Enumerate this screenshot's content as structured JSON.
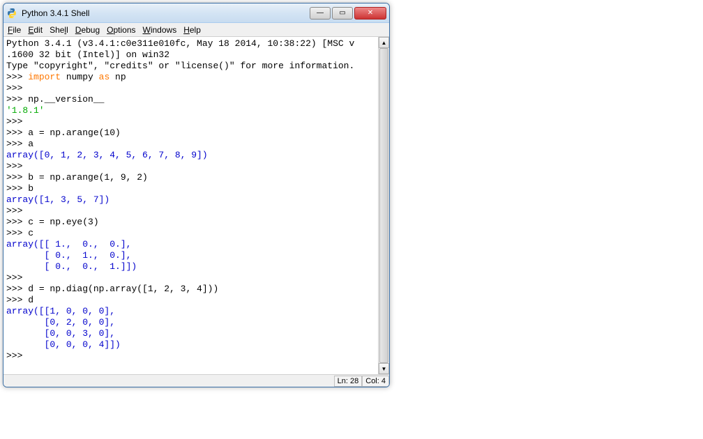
{
  "title": "Python 3.4.1 Shell",
  "menus": {
    "file": "File",
    "edit": "Edit",
    "shell": "Shell",
    "debug": "Debug",
    "options": "Options",
    "windows": "Windows",
    "help": "Help"
  },
  "banner": {
    "line1": "Python 3.4.1 (v3.4.1:c0e311e010fc, May 18 2014, 10:38:22) [MSC v",
    "line2": ".1600 32 bit (Intel)] on win32",
    "line3": "Type \"copyright\", \"credits\" or \"license()\" for more information."
  },
  "session": {
    "p": ">>> ",
    "kw_import": "import",
    "kw_as": "as",
    "imp_mid": " numpy ",
    "imp_tail": " np",
    "ver_cmd": "np.__version__",
    "ver_out": "'1.8.1'",
    "a_assign": "a = np.arange(10)",
    "a_echo": "a",
    "a_out": "array([0, 1, 2, 3, 4, 5, 6, 7, 8, 9])",
    "b_assign": "b = np.arange(1, 9, 2)",
    "b_echo": "b",
    "b_out": "array([1, 3, 5, 7])",
    "c_assign": "c = np.eye(3)",
    "c_echo": "c",
    "c_out1": "array([[ 1.,  0.,  0.],",
    "c_out2": "       [ 0.,  1.,  0.],",
    "c_out3": "       [ 0.,  0.,  1.]])",
    "d_assign": "d = np.diag(np.array([1, 2, 3, 4]))",
    "d_echo": "d",
    "d_out1": "array([[1, 0, 0, 0],",
    "d_out2": "       [0, 2, 0, 0],",
    "d_out3": "       [0, 0, 3, 0],",
    "d_out4": "       [0, 0, 0, 4]])"
  },
  "status": {
    "ln": "Ln: 28",
    "col": "Col: 4"
  },
  "glyphs": {
    "up": "▲",
    "down": "▼",
    "x": "✕",
    "min": "—",
    "max": "▭"
  }
}
